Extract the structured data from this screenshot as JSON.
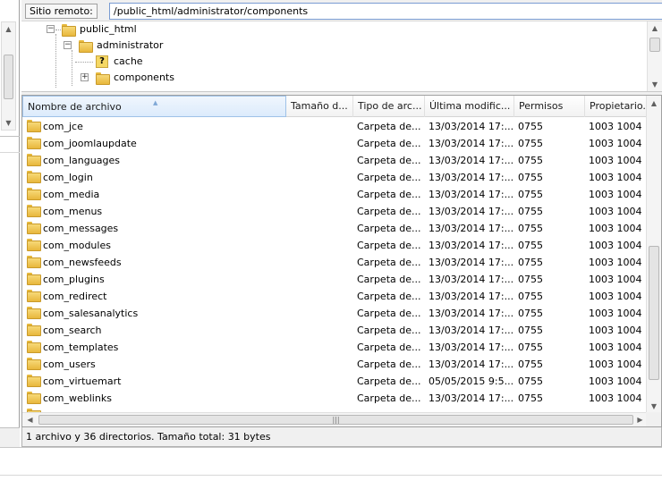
{
  "remote": {
    "label": "Sitio remoto:",
    "path": "/public_html/administrator/components"
  },
  "tree": {
    "nodes": [
      {
        "label": "public_html",
        "expander": "−"
      },
      {
        "label": "administrator",
        "expander": "−"
      },
      {
        "label": "cache",
        "icon": "question-icon"
      },
      {
        "label": "components",
        "expander": "+"
      }
    ]
  },
  "list": {
    "columns": [
      "Nombre de archivo",
      "Tamaño d...",
      "Tipo de arc...",
      "Última modific...",
      "Permisos",
      "Propietario..."
    ],
    "rows": [
      {
        "name": "com_jce",
        "type": "Carpeta de...",
        "modified": "13/03/2014 17:...",
        "perms": "0755",
        "owner": "1003 1004"
      },
      {
        "name": "com_joomlaupdate",
        "type": "Carpeta de...",
        "modified": "13/03/2014 17:...",
        "perms": "0755",
        "owner": "1003 1004"
      },
      {
        "name": "com_languages",
        "type": "Carpeta de...",
        "modified": "13/03/2014 17:...",
        "perms": "0755",
        "owner": "1003 1004"
      },
      {
        "name": "com_login",
        "type": "Carpeta de...",
        "modified": "13/03/2014 17:...",
        "perms": "0755",
        "owner": "1003 1004"
      },
      {
        "name": "com_media",
        "type": "Carpeta de...",
        "modified": "13/03/2014 17:...",
        "perms": "0755",
        "owner": "1003 1004"
      },
      {
        "name": "com_menus",
        "type": "Carpeta de...",
        "modified": "13/03/2014 17:...",
        "perms": "0755",
        "owner": "1003 1004"
      },
      {
        "name": "com_messages",
        "type": "Carpeta de...",
        "modified": "13/03/2014 17:...",
        "perms": "0755",
        "owner": "1003 1004"
      },
      {
        "name": "com_modules",
        "type": "Carpeta de...",
        "modified": "13/03/2014 17:...",
        "perms": "0755",
        "owner": "1003 1004"
      },
      {
        "name": "com_newsfeeds",
        "type": "Carpeta de...",
        "modified": "13/03/2014 17:...",
        "perms": "0755",
        "owner": "1003 1004"
      },
      {
        "name": "com_plugins",
        "type": "Carpeta de...",
        "modified": "13/03/2014 17:...",
        "perms": "0755",
        "owner": "1003 1004"
      },
      {
        "name": "com_redirect",
        "type": "Carpeta de...",
        "modified": "13/03/2014 17:...",
        "perms": "0755",
        "owner": "1003 1004"
      },
      {
        "name": "com_salesanalytics",
        "type": "Carpeta de...",
        "modified": "13/03/2014 17:...",
        "perms": "0755",
        "owner": "1003 1004"
      },
      {
        "name": "com_search",
        "type": "Carpeta de...",
        "modified": "13/03/2014 17:...",
        "perms": "0755",
        "owner": "1003 1004"
      },
      {
        "name": "com_templates",
        "type": "Carpeta de...",
        "modified": "13/03/2014 17:...",
        "perms": "0755",
        "owner": "1003 1004"
      },
      {
        "name": "com_users",
        "type": "Carpeta de...",
        "modified": "13/03/2014 17:...",
        "perms": "0755",
        "owner": "1003 1004"
      },
      {
        "name": "com_virtuemart",
        "type": "Carpeta de...",
        "modified": "05/05/2015 9:5...",
        "perms": "0755",
        "owner": "1003 1004"
      },
      {
        "name": "com_weblinks",
        "type": "Carpeta de...",
        "modified": "13/03/2014 17:...",
        "perms": "0755",
        "owner": "1003 1004"
      }
    ]
  },
  "status": {
    "text": "1 archivo y 36 directorios. Tamaño total: 31 bytes"
  },
  "colors": {
    "folder": "#e8b73c",
    "path_border": "#7a9cd3",
    "sorted_header": "#dcebfc"
  }
}
